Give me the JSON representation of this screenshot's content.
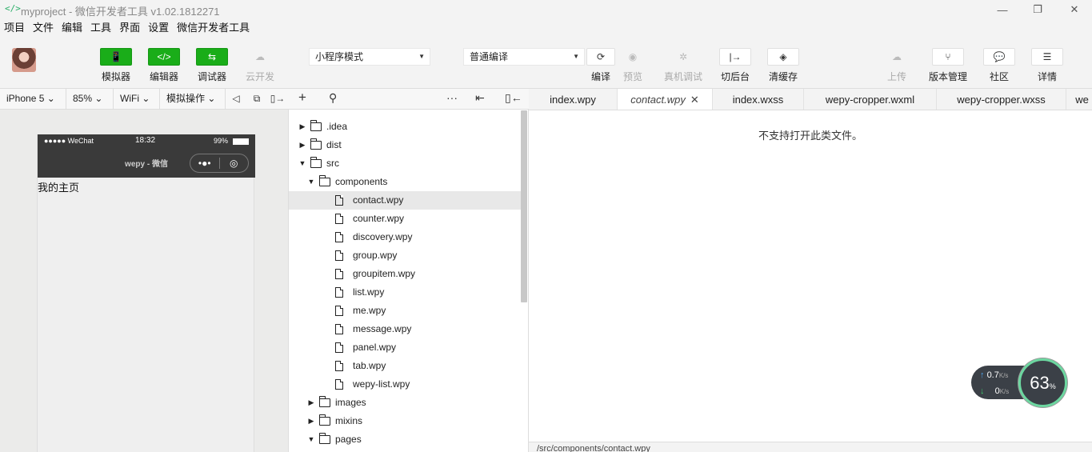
{
  "window": {
    "app_icon": "</>",
    "title": "myproject - 微信开发者工具 v1.02.1812271",
    "minimize": "—",
    "restore": "❐",
    "close": "✕"
  },
  "menu": [
    "项目",
    "文件",
    "编辑",
    "工具",
    "界面",
    "设置",
    "微信开发者工具"
  ],
  "toolbar": {
    "simulator": "模拟器",
    "editor": "编辑器",
    "debugger": "调试器",
    "cloud": "云开发",
    "mode_select": "小程序模式",
    "compile_select": "普通编译",
    "compile": "编译",
    "preview": "预览",
    "remote_debug": "真机调试",
    "background": "切后台",
    "clear_cache": "清缓存",
    "upload": "上传",
    "version": "版本管理",
    "community": "社区",
    "details": "详情",
    "icons": {
      "simulator": "📱",
      "editor": "</>",
      "debugger": "⇆",
      "cloud": "☁",
      "compile": "⟳",
      "preview": "◉",
      "remote_debug": "✲",
      "background": "|→",
      "clear_cache": "◈",
      "upload": "☁",
      "version": "⑂",
      "community": "💬",
      "details": "☰"
    },
    "green": "#1aad19"
  },
  "simbar": {
    "device": "iPhone 5",
    "zoom": "85%",
    "network": "WiFi",
    "operation": "模拟操作"
  },
  "phone": {
    "signal": "●●●●● WeChat",
    "time": "18:32",
    "battery": "99%",
    "nav_title": "wepy - 微信",
    "page_text": "我的主页"
  },
  "tree": {
    "rows": [
      {
        "name": ".idea",
        "type": "folder",
        "expanded": false,
        "depth": 0
      },
      {
        "name": "dist",
        "type": "folder",
        "expanded": false,
        "depth": 0
      },
      {
        "name": "src",
        "type": "folder",
        "expanded": true,
        "depth": 0
      },
      {
        "name": "components",
        "type": "folder",
        "expanded": true,
        "depth": 1
      },
      {
        "name": "contact.wpy",
        "type": "file",
        "depth": 2,
        "selected": true
      },
      {
        "name": "counter.wpy",
        "type": "file",
        "depth": 2
      },
      {
        "name": "discovery.wpy",
        "type": "file",
        "depth": 2
      },
      {
        "name": "group.wpy",
        "type": "file",
        "depth": 2
      },
      {
        "name": "groupitem.wpy",
        "type": "file",
        "depth": 2
      },
      {
        "name": "list.wpy",
        "type": "file",
        "depth": 2
      },
      {
        "name": "me.wpy",
        "type": "file",
        "depth": 2
      },
      {
        "name": "message.wpy",
        "type": "file",
        "depth": 2
      },
      {
        "name": "panel.wpy",
        "type": "file",
        "depth": 2
      },
      {
        "name": "tab.wpy",
        "type": "file",
        "depth": 2
      },
      {
        "name": "wepy-list.wpy",
        "type": "file",
        "depth": 2
      },
      {
        "name": "images",
        "type": "folder",
        "expanded": false,
        "depth": 1
      },
      {
        "name": "mixins",
        "type": "folder",
        "expanded": false,
        "depth": 1
      },
      {
        "name": "pages",
        "type": "folder",
        "expanded": true,
        "depth": 1
      }
    ]
  },
  "tabs": [
    {
      "label": "index.wpy",
      "active": false
    },
    {
      "label": "contact.wpy",
      "active": true
    },
    {
      "label": "index.wxss",
      "active": false
    },
    {
      "label": "wepy-cropper.wxml",
      "active": false
    },
    {
      "label": "wepy-cropper.wxss",
      "active": false
    },
    {
      "label": "we",
      "active": false
    }
  ],
  "editor": {
    "message": "不支持打开此类文件。",
    "status_path": "/src/components/contact.wpy"
  },
  "net": {
    "up": "0.7",
    "down": "0",
    "unit": "K/s",
    "cpu": "63"
  }
}
